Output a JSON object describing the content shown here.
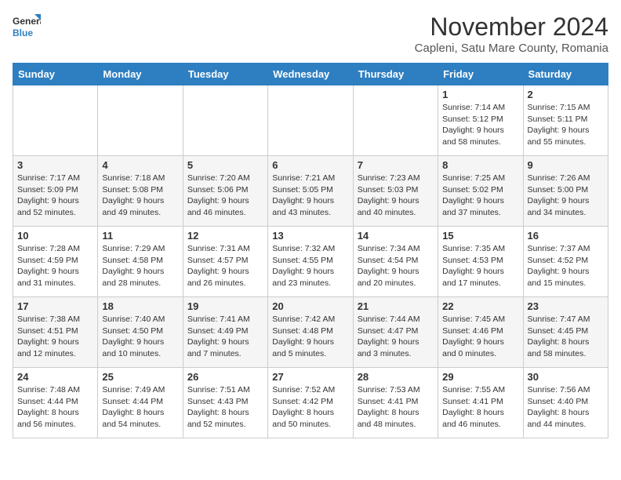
{
  "logo": {
    "line1": "General",
    "line2": "Blue"
  },
  "title": "November 2024",
  "subtitle": "Capleni, Satu Mare County, Romania",
  "weekdays": [
    "Sunday",
    "Monday",
    "Tuesday",
    "Wednesday",
    "Thursday",
    "Friday",
    "Saturday"
  ],
  "weeks": [
    [
      {
        "day": "",
        "info": ""
      },
      {
        "day": "",
        "info": ""
      },
      {
        "day": "",
        "info": ""
      },
      {
        "day": "",
        "info": ""
      },
      {
        "day": "",
        "info": ""
      },
      {
        "day": "1",
        "info": "Sunrise: 7:14 AM\nSunset: 5:12 PM\nDaylight: 9 hours and 58 minutes."
      },
      {
        "day": "2",
        "info": "Sunrise: 7:15 AM\nSunset: 5:11 PM\nDaylight: 9 hours and 55 minutes."
      }
    ],
    [
      {
        "day": "3",
        "info": "Sunrise: 7:17 AM\nSunset: 5:09 PM\nDaylight: 9 hours and 52 minutes."
      },
      {
        "day": "4",
        "info": "Sunrise: 7:18 AM\nSunset: 5:08 PM\nDaylight: 9 hours and 49 minutes."
      },
      {
        "day": "5",
        "info": "Sunrise: 7:20 AM\nSunset: 5:06 PM\nDaylight: 9 hours and 46 minutes."
      },
      {
        "day": "6",
        "info": "Sunrise: 7:21 AM\nSunset: 5:05 PM\nDaylight: 9 hours and 43 minutes."
      },
      {
        "day": "7",
        "info": "Sunrise: 7:23 AM\nSunset: 5:03 PM\nDaylight: 9 hours and 40 minutes."
      },
      {
        "day": "8",
        "info": "Sunrise: 7:25 AM\nSunset: 5:02 PM\nDaylight: 9 hours and 37 minutes."
      },
      {
        "day": "9",
        "info": "Sunrise: 7:26 AM\nSunset: 5:00 PM\nDaylight: 9 hours and 34 minutes."
      }
    ],
    [
      {
        "day": "10",
        "info": "Sunrise: 7:28 AM\nSunset: 4:59 PM\nDaylight: 9 hours and 31 minutes."
      },
      {
        "day": "11",
        "info": "Sunrise: 7:29 AM\nSunset: 4:58 PM\nDaylight: 9 hours and 28 minutes."
      },
      {
        "day": "12",
        "info": "Sunrise: 7:31 AM\nSunset: 4:57 PM\nDaylight: 9 hours and 26 minutes."
      },
      {
        "day": "13",
        "info": "Sunrise: 7:32 AM\nSunset: 4:55 PM\nDaylight: 9 hours and 23 minutes."
      },
      {
        "day": "14",
        "info": "Sunrise: 7:34 AM\nSunset: 4:54 PM\nDaylight: 9 hours and 20 minutes."
      },
      {
        "day": "15",
        "info": "Sunrise: 7:35 AM\nSunset: 4:53 PM\nDaylight: 9 hours and 17 minutes."
      },
      {
        "day": "16",
        "info": "Sunrise: 7:37 AM\nSunset: 4:52 PM\nDaylight: 9 hours and 15 minutes."
      }
    ],
    [
      {
        "day": "17",
        "info": "Sunrise: 7:38 AM\nSunset: 4:51 PM\nDaylight: 9 hours and 12 minutes."
      },
      {
        "day": "18",
        "info": "Sunrise: 7:40 AM\nSunset: 4:50 PM\nDaylight: 9 hours and 10 minutes."
      },
      {
        "day": "19",
        "info": "Sunrise: 7:41 AM\nSunset: 4:49 PM\nDaylight: 9 hours and 7 minutes."
      },
      {
        "day": "20",
        "info": "Sunrise: 7:42 AM\nSunset: 4:48 PM\nDaylight: 9 hours and 5 minutes."
      },
      {
        "day": "21",
        "info": "Sunrise: 7:44 AM\nSunset: 4:47 PM\nDaylight: 9 hours and 3 minutes."
      },
      {
        "day": "22",
        "info": "Sunrise: 7:45 AM\nSunset: 4:46 PM\nDaylight: 9 hours and 0 minutes."
      },
      {
        "day": "23",
        "info": "Sunrise: 7:47 AM\nSunset: 4:45 PM\nDaylight: 8 hours and 58 minutes."
      }
    ],
    [
      {
        "day": "24",
        "info": "Sunrise: 7:48 AM\nSunset: 4:44 PM\nDaylight: 8 hours and 56 minutes."
      },
      {
        "day": "25",
        "info": "Sunrise: 7:49 AM\nSunset: 4:44 PM\nDaylight: 8 hours and 54 minutes."
      },
      {
        "day": "26",
        "info": "Sunrise: 7:51 AM\nSunset: 4:43 PM\nDaylight: 8 hours and 52 minutes."
      },
      {
        "day": "27",
        "info": "Sunrise: 7:52 AM\nSunset: 4:42 PM\nDaylight: 8 hours and 50 minutes."
      },
      {
        "day": "28",
        "info": "Sunrise: 7:53 AM\nSunset: 4:41 PM\nDaylight: 8 hours and 48 minutes."
      },
      {
        "day": "29",
        "info": "Sunrise: 7:55 AM\nSunset: 4:41 PM\nDaylight: 8 hours and 46 minutes."
      },
      {
        "day": "30",
        "info": "Sunrise: 7:56 AM\nSunset: 4:40 PM\nDaylight: 8 hours and 44 minutes."
      }
    ]
  ]
}
